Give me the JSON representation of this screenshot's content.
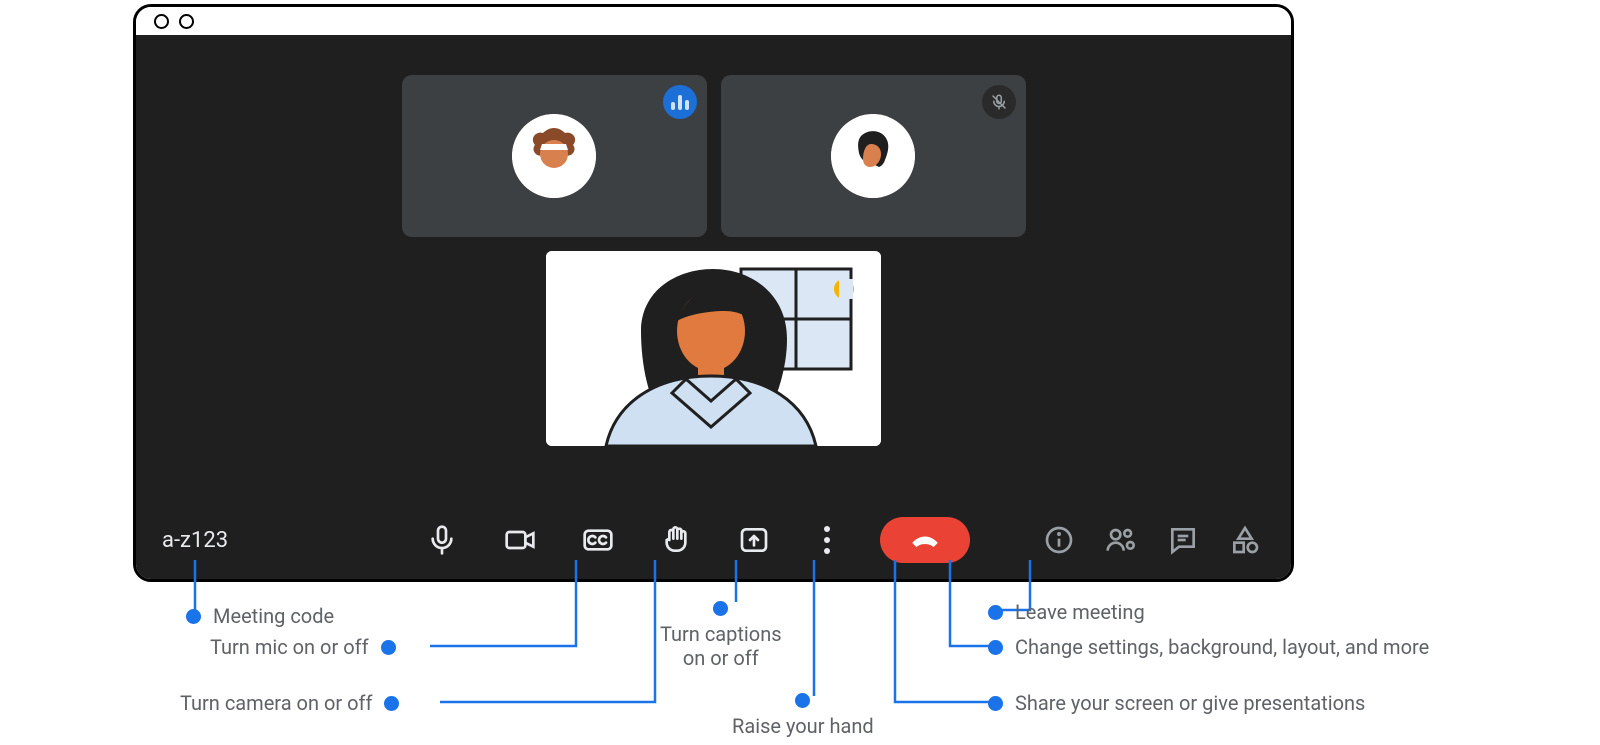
{
  "meeting": {
    "code": "a-z123",
    "participants": [
      {
        "status": "speaking"
      },
      {
        "status": "muted"
      }
    ]
  },
  "toolbar": {
    "icons": {
      "mic": "microphone-icon",
      "camera": "camera-icon",
      "captions": "captions-icon",
      "hand": "raise-hand-icon",
      "present": "present-screen-icon",
      "more": "more-options-icon",
      "leave": "hang-up-icon",
      "info": "meeting-info-icon",
      "people": "people-icon",
      "chat": "chat-icon",
      "activities": "activities-icon"
    }
  },
  "annotations": {
    "meeting_code": "Meeting code",
    "mic": "Turn mic on or off",
    "camera": "Turn camera on or off",
    "captions": "Turn captions\non or off",
    "hand": "Raise your hand",
    "present": "Share your screen or give presentations",
    "more": "Change settings, background, layout, and more",
    "leave": "Leave meeting"
  },
  "colors": {
    "accent": "#1a73e8",
    "danger": "#ea4335",
    "surface": "#1f1f1f",
    "tile": "#3c4043",
    "annotation_text": "#5f6368"
  }
}
